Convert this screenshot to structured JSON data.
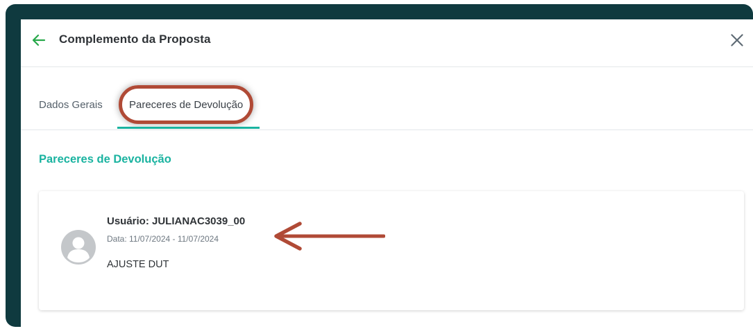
{
  "header": {
    "title": "Complemento da Proposta",
    "back_icon": "arrow-left-icon",
    "close_icon": "close-icon"
  },
  "tabs": [
    {
      "label": "Dados Gerais",
      "active": false
    },
    {
      "label": "Pareceres de Devolução",
      "active": true
    }
  ],
  "section": {
    "title": "Pareceres de Devolução"
  },
  "record": {
    "user": "Usuário: JULIANAC3039_00",
    "date": "Data: 11/07/2024 - 11/07/2024",
    "note": "AJUSTE DUT",
    "avatar_icon": "user-avatar-icon"
  },
  "colors": {
    "accent": "#1ab3a0",
    "frame": "#0f3a3f",
    "annotation": "#b04a36"
  }
}
